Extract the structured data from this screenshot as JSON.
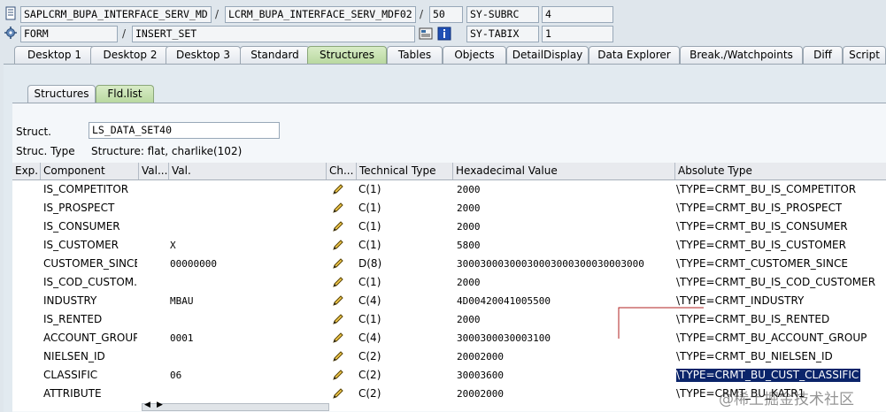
{
  "header": {
    "program": "SAPLCRM_BUPA_INTERFACE_SERV_MD",
    "include": "LCRM_BUPA_INTERFACE_SERV_MDF02",
    "line": "50",
    "subrc_label": "SY-SUBRC",
    "subrc_value": "4",
    "event_type": "FORM",
    "event_name": "INSERT_SET",
    "tabix_label": "SY-TABIX",
    "tabix_value": "1",
    "separator": "/"
  },
  "tabs": [
    "Desktop 1",
    "Desktop 2",
    "Desktop 3",
    "Standard",
    "Structures",
    "Tables",
    "Objects",
    "DetailDisplay",
    "Data Explorer",
    "Break./Watchpoints",
    "Diff",
    "Script"
  ],
  "active_tab": "Structures",
  "subtabs": [
    "Structures",
    "Fld.list"
  ],
  "active_subtab": "Fld.list",
  "struct": {
    "label": "Struct.",
    "value": "LS_DATA_SET40",
    "type_label": "Struc. Type",
    "type_value": "Structure: flat, charlike(102)"
  },
  "table": {
    "columns": [
      "Exp.",
      "Component",
      "Val...",
      "Val.",
      "Ch...",
      "Technical Type",
      "Hexadecimal Value",
      "Absolute Type"
    ],
    "rows": [
      {
        "component": "IS_COMPETITOR",
        "val": "",
        "type": "C(1)",
        "hex": "2000",
        "abs": "\\TYPE=CRMT_BU_IS_COMPETITOR"
      },
      {
        "component": "IS_PROSPECT",
        "val": "",
        "type": "C(1)",
        "hex": "2000",
        "abs": "\\TYPE=CRMT_BU_IS_PROSPECT"
      },
      {
        "component": "IS_CONSUMER",
        "val": "",
        "type": "C(1)",
        "hex": "2000",
        "abs": "\\TYPE=CRMT_BU_IS_CONSUMER"
      },
      {
        "component": "IS_CUSTOMER",
        "val": "X",
        "type": "C(1)",
        "hex": "5800",
        "abs": "\\TYPE=CRMT_BU_IS_CUSTOMER"
      },
      {
        "component": "CUSTOMER_SINCE",
        "val": "00000000",
        "type": "D(8)",
        "hex": "30003000300030003000300030003000",
        "abs": "\\TYPE=CRMT_CUSTOMER_SINCE"
      },
      {
        "component": "IS_COD_CUSTOM...",
        "val": "",
        "type": "C(1)",
        "hex": "2000",
        "abs": "\\TYPE=CRMT_BU_IS_COD_CUSTOMER"
      },
      {
        "component": "INDUSTRY",
        "val": "MBAU",
        "type": "C(4)",
        "hex": "4D00420041005500",
        "abs": "\\TYPE=CRMT_INDUSTRY"
      },
      {
        "component": "IS_RENTED",
        "val": "",
        "type": "C(1)",
        "hex": "2000",
        "abs": "\\TYPE=CRMT_BU_IS_RENTED"
      },
      {
        "component": "ACCOUNT_GROUP",
        "val": "0001",
        "type": "C(4)",
        "hex": "3000300030003100",
        "abs": "\\TYPE=CRMT_BU_ACCOUNT_GROUP"
      },
      {
        "component": "NIELSEN_ID",
        "val": "",
        "type": "C(2)",
        "hex": "20002000",
        "abs": "\\TYPE=CRMT_BU_NIELSEN_ID"
      },
      {
        "component": "CLASSIFIC",
        "val": "06",
        "type": "C(2)",
        "hex": "30003600",
        "abs": "\\TYPE=CRMT_BU_CUST_CLASSIFIC",
        "selected": true
      },
      {
        "component": "ATTRIBUTE",
        "val": "",
        "type": "C(2)",
        "hex": "20002000",
        "abs": "\\TYPE=CRMT_BU_KATR1"
      }
    ]
  },
  "watermark": "@稀土掘金技术社区",
  "colors": {
    "active_tab": "#b9d9a0",
    "selection": "#0a246a",
    "annotation_line": "#b22222"
  }
}
